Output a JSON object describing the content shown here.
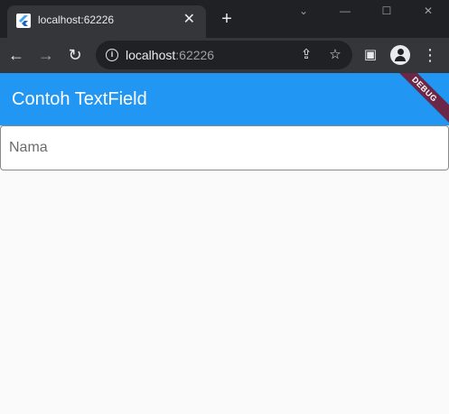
{
  "browser": {
    "tab": {
      "title": "localhost:62226",
      "close": "✕"
    },
    "new_tab": "+",
    "window_controls": {
      "minimize": "—",
      "maximize": "☐",
      "close": "✕",
      "dropdown": "⌄"
    },
    "toolbar": {
      "back": "←",
      "forward": "→",
      "reload": "↻",
      "url_host": "localhost",
      "url_port": ":62226",
      "share_icon": "⇪",
      "star_icon": "☆",
      "sidebar_icon": "▣",
      "menu_icon": "⋮"
    }
  },
  "app": {
    "title": "Contoh TextField",
    "debug_banner": "DEBUG",
    "textfield": {
      "placeholder": "Nama",
      "value": ""
    },
    "colors": {
      "appbar": "#2196f3",
      "background": "#fafafa"
    }
  }
}
